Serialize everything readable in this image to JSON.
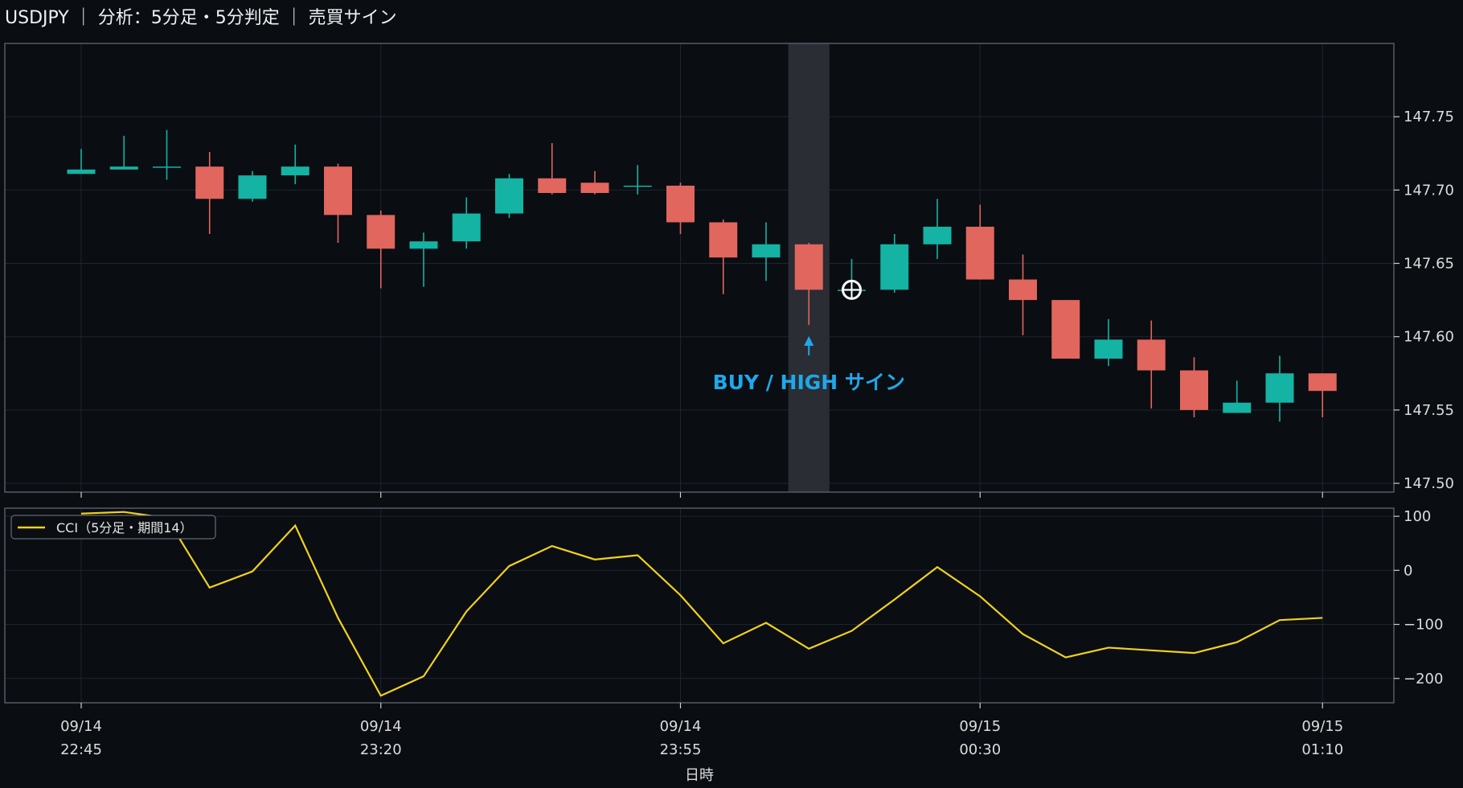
{
  "header": {
    "title": "USDJPY ｜ 分析：5分足・5分判定 ｜ 売買サイン"
  },
  "colors": {
    "background": "#0a0d12",
    "up": "#14b3a3",
    "down": "#e0665e",
    "cci": "#f1d21c",
    "signal": "#1fa8ea",
    "grid": "#1f2530",
    "frame": "#555b66"
  },
  "chart_data": [
    {
      "type": "candlestick",
      "x": [
        "09/14 22:45",
        "09/14 22:50",
        "09/14 22:55",
        "09/14 23:00",
        "09/14 23:05",
        "09/14 23:10",
        "09/14 23:15",
        "09/14 23:20",
        "09/14 23:25",
        "09/14 23:30",
        "09/14 23:35",
        "09/14 23:40",
        "09/14 23:45",
        "09/14 23:50",
        "09/14 23:55",
        "09/15 00:00",
        "09/15 00:05",
        "09/15 00:10",
        "09/15 00:15",
        "09/15 00:20",
        "09/15 00:25",
        "09/15 00:30",
        "09/15 00:35",
        "09/15 00:40",
        "09/15 00:45",
        "09/15 00:50",
        "09/15 00:55",
        "09/15 01:00",
        "09/15 01:05",
        "09/15 01:10"
      ],
      "open": [
        147.711,
        147.714,
        147.716,
        147.716,
        147.694,
        147.71,
        147.716,
        147.683,
        147.66,
        147.665,
        147.684,
        147.708,
        147.705,
        147.703,
        147.703,
        147.678,
        147.654,
        147.663,
        147.632,
        147.632,
        147.663,
        147.675,
        147.639,
        147.625,
        147.585,
        147.598,
        147.577,
        147.548,
        147.555,
        147.575
      ],
      "high": [
        147.728,
        147.737,
        147.741,
        147.726,
        147.713,
        147.731,
        147.718,
        147.686,
        147.671,
        147.695,
        147.711,
        147.732,
        147.713,
        147.717,
        147.705,
        147.68,
        147.678,
        147.664,
        147.653,
        147.67,
        147.694,
        147.69,
        147.656,
        147.625,
        147.612,
        147.611,
        147.586,
        147.57,
        147.587,
        147.575
      ],
      "low": [
        147.711,
        147.714,
        147.707,
        147.67,
        147.692,
        147.704,
        147.664,
        147.633,
        147.634,
        147.66,
        147.681,
        147.697,
        147.697,
        147.697,
        147.67,
        147.629,
        147.638,
        147.608,
        147.631,
        147.63,
        147.653,
        147.639,
        147.601,
        147.585,
        147.58,
        147.551,
        147.545,
        147.548,
        147.542,
        147.545
      ],
      "close": [
        147.714,
        147.716,
        147.716,
        147.694,
        147.71,
        147.716,
        147.683,
        147.66,
        147.665,
        147.684,
        147.708,
        147.698,
        147.698,
        147.703,
        147.678,
        147.654,
        147.663,
        147.632,
        147.632,
        147.663,
        147.675,
        147.639,
        147.625,
        147.585,
        147.598,
        147.577,
        147.55,
        147.555,
        147.575,
        147.563
      ],
      "ylim": [
        147.494,
        147.8
      ],
      "yticks": [
        147.5,
        147.55,
        147.6,
        147.65,
        147.7,
        147.75
      ],
      "ytick_labels": [
        "147.50",
        "147.55",
        "147.60",
        "147.65",
        "147.70",
        "147.75"
      ],
      "xticks": [
        {
          "index": 0,
          "label1": "09/14",
          "label2": "22:45"
        },
        {
          "index": 7,
          "label1": "09/14",
          "label2": "23:20"
        },
        {
          "index": 14,
          "label1": "09/14",
          "label2": "23:55"
        },
        {
          "index": 21,
          "label1": "09/15",
          "label2": "00:30"
        },
        {
          "index": 29,
          "label1": "09/15",
          "label2": "01:10"
        }
      ],
      "xlabel": "日時",
      "highlight_index": 17,
      "signal": {
        "index": 17,
        "price": 147.596,
        "label": "BUY / HIGH サイン"
      },
      "entry_marker": {
        "index": 18,
        "price": 147.632
      }
    },
    {
      "type": "line",
      "series": [
        {
          "name": "CCI（5分足・期間14）",
          "values": [
            105,
            108,
            97,
            -32,
            -2,
            83,
            -88,
            -232,
            -196,
            -76,
            8,
            45,
            20,
            28,
            -46,
            -135,
            -97,
            -145,
            -112,
            -54,
            6,
            -48,
            -118,
            -161,
            -143,
            -148,
            -153,
            -133,
            -92,
            -88
          ]
        }
      ],
      "ylim": [
        -245,
        115
      ],
      "yticks": [
        -200,
        -100,
        0,
        100
      ],
      "ytick_labels": [
        "−200",
        "−100",
        "0",
        "100"
      ],
      "legend": "upper-left"
    }
  ]
}
